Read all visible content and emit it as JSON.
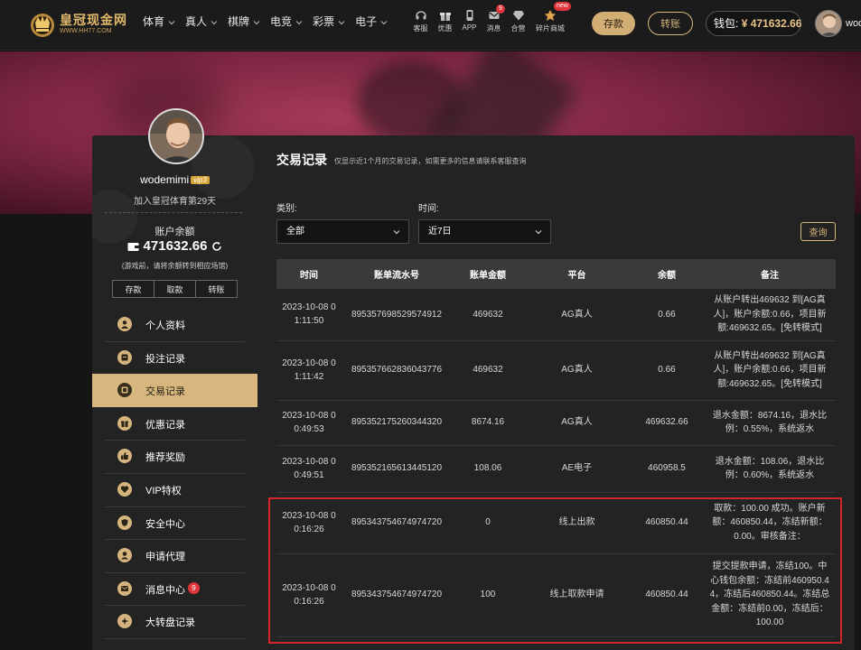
{
  "brand": {
    "title": "皇冠现金网",
    "url": "WWW.HH77.COM"
  },
  "nav": {
    "items": [
      {
        "label": "体育"
      },
      {
        "label": "真人"
      },
      {
        "label": "棋牌"
      },
      {
        "label": "电竞"
      },
      {
        "label": "彩票"
      },
      {
        "label": "电子"
      }
    ]
  },
  "quick": {
    "items": [
      {
        "label": "客服",
        "icon": "headset-icon"
      },
      {
        "label": "优惠",
        "icon": "gift-icon"
      },
      {
        "label": "APP",
        "icon": "phone-icon"
      },
      {
        "label": "消息",
        "icon": "message-icon",
        "badge": "9"
      },
      {
        "label": "合营",
        "icon": "diamond-icon"
      },
      {
        "label": "碎片商城",
        "icon": "shop-icon",
        "badge": "new"
      }
    ]
  },
  "header": {
    "deposit_label": "存款",
    "transfer_label": "转账",
    "wallet_label": "钱包:",
    "wallet_amount": "¥ 471632.66",
    "username": "wodemimi"
  },
  "profile": {
    "username": "wodemimi",
    "vip": "vip3",
    "joined": "加入皇冠体育第29天",
    "balance_label": "账户余额",
    "balance": "471632.66",
    "tip": "(游戏前，请将余额转到相应场馆)",
    "btn_deposit": "存款",
    "btn_withdraw": "取款",
    "btn_transfer": "转账"
  },
  "menu": {
    "items": [
      {
        "label": "个人资料",
        "icon": "user-icon"
      },
      {
        "label": "投注记录",
        "icon": "bet-record-icon"
      },
      {
        "label": "交易记录",
        "icon": "transaction-icon",
        "active": true
      },
      {
        "label": "优惠记录",
        "icon": "gift-icon"
      },
      {
        "label": "推荐奖励",
        "icon": "thumbs-up-icon"
      },
      {
        "label": "VIP特权",
        "icon": "heart-icon"
      },
      {
        "label": "安全中心",
        "icon": "shield-icon"
      },
      {
        "label": "申请代理",
        "icon": "agent-icon"
      },
      {
        "label": "消息中心",
        "icon": "message-icon",
        "badge": "9"
      },
      {
        "label": "大转盘记录",
        "icon": "wheel-icon"
      }
    ]
  },
  "main": {
    "title": "交易记录",
    "subtitle": "仅显示近1个月的交易记录，如需更多的信息请联系客服查询",
    "category_label": "类别:",
    "category_value": "全部",
    "time_label": "时间:",
    "time_value": "近7日",
    "query_label": "查询"
  },
  "table": {
    "columns": [
      "时间",
      "账单流水号",
      "账单金额",
      "平台",
      "余额",
      "备注"
    ],
    "rows": [
      {
        "time": "2023-10-08 01:11:50",
        "serial": "895357698529574912",
        "amount": "469632",
        "platform": "AG真人",
        "balance": "0.66",
        "note": "从账户转出469632 到[AG真人]，账户余额:0.66，项目新额:469632.65。[免转模式]"
      },
      {
        "time": "2023-10-08 01:11:42",
        "serial": "895357662836043776",
        "amount": "469632",
        "platform": "AG真人",
        "balance": "0.66",
        "note": "从账户转出469632 到[AG真人]，账户余额:0.66，项目新额:469632.65。[免转模式]"
      },
      {
        "time": "2023-10-08 00:49:53",
        "serial": "895352175260344320",
        "amount": "8674.16",
        "platform": "AG真人",
        "balance": "469632.66",
        "note": "退水金额：8674.16，退水比例：0.55%，系统返水"
      },
      {
        "time": "2023-10-08 00:49:51",
        "serial": "895352165613445120",
        "amount": "108.06",
        "platform": "AE电子",
        "balance": "460958.5",
        "note": "退水金额：108.06，退水比例：0.60%，系统返水"
      },
      {
        "time": "2023-10-08 00:16:26",
        "serial": "895343754674974720",
        "amount": "0",
        "platform": "线上出款",
        "balance": "460850.44",
        "note": "取款：100.00 成功。账户新额：460850.44，冻结新额：0.00。审核备注："
      },
      {
        "time": "2023-10-08 00:16:26",
        "serial": "895343754674974720",
        "amount": "100",
        "platform": "线上取款申请",
        "balance": "460850.44",
        "note": "提交提款申请，冻结100。中心钱包余额：冻结前460950.44，冻结后460850.44。冻结总金额：冻结前0.00，冻结后：100.00"
      }
    ]
  },
  "colors": {
    "accent": "#d7b77e",
    "highlight_border": "#d1262c",
    "badge": "#e0353a"
  }
}
